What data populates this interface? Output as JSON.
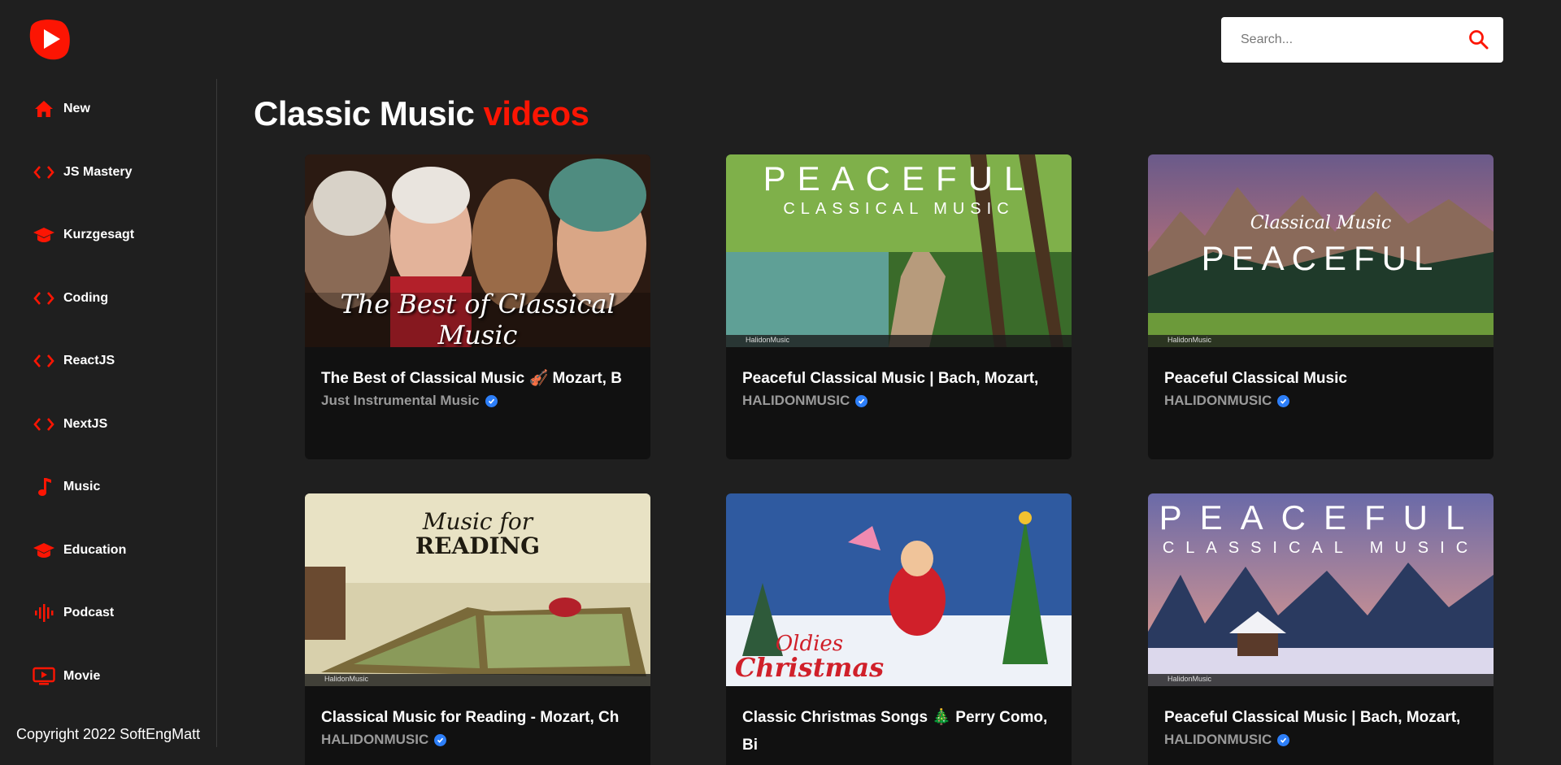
{
  "header": {
    "logo_icon": "play-logo-icon",
    "search": {
      "placeholder": "Search...",
      "icon": "search-icon"
    }
  },
  "sidebar": {
    "items": [
      {
        "label": "New",
        "icon": "home-icon"
      },
      {
        "label": "JS Mastery",
        "icon": "code-icon"
      },
      {
        "label": "Kurzgesagt",
        "icon": "graduation-cap-icon"
      },
      {
        "label": "Coding",
        "icon": "code-icon"
      },
      {
        "label": "ReactJS",
        "icon": "code-icon"
      },
      {
        "label": "NextJS",
        "icon": "code-icon"
      },
      {
        "label": "Music",
        "icon": "music-note-icon"
      },
      {
        "label": "Education",
        "icon": "graduation-cap-icon"
      },
      {
        "label": "Podcast",
        "icon": "audio-wave-icon"
      },
      {
        "label": "Movie",
        "icon": "tv-icon"
      }
    ],
    "copyright": "Copyright 2022 SoftEngMatt"
  },
  "main": {
    "title_prefix": "Classic Music",
    "title_accent": "videos",
    "accent_color": "#fc1503",
    "verified_color": "#2d7ff9",
    "videos": [
      {
        "title": "The Best of Classical Music 🎻 Mozart, B",
        "channel": "Just Instrumental Music",
        "thumb_text": "The Best of Classical Music"
      },
      {
        "title": "Peaceful Classical Music | Bach, Mozart,",
        "channel": "HALIDONMUSIC",
        "thumb_text": "PEACEFUL",
        "thumb_subtext": "CLASSICAL MUSIC",
        "thumb_watermark": "HalidonMusic"
      },
      {
        "title": "Peaceful Classical Music",
        "channel": "HALIDONMUSIC",
        "thumb_text": "PEACEFUL",
        "thumb_subtext": "Classical Music",
        "thumb_watermark": "HalidonMusic"
      },
      {
        "title": "Classical Music for Reading - Mozart, Ch",
        "channel": "HALIDONMUSIC",
        "thumb_text": "READING",
        "thumb_subtext": "Music for",
        "thumb_watermark": "HalidonMusic"
      },
      {
        "title": "Classic Christmas Songs 🎄 Perry Como, Bi",
        "channel": "",
        "thumb_text": "Christmas",
        "thumb_subtext": "Oldies"
      },
      {
        "title": "Peaceful Classical Music | Bach, Mozart,",
        "channel": "HALIDONMUSIC",
        "thumb_text": "PEACEFUL",
        "thumb_subtext": "CLASSICAL MUSIC",
        "thumb_watermark": "HalidonMusic"
      }
    ]
  }
}
